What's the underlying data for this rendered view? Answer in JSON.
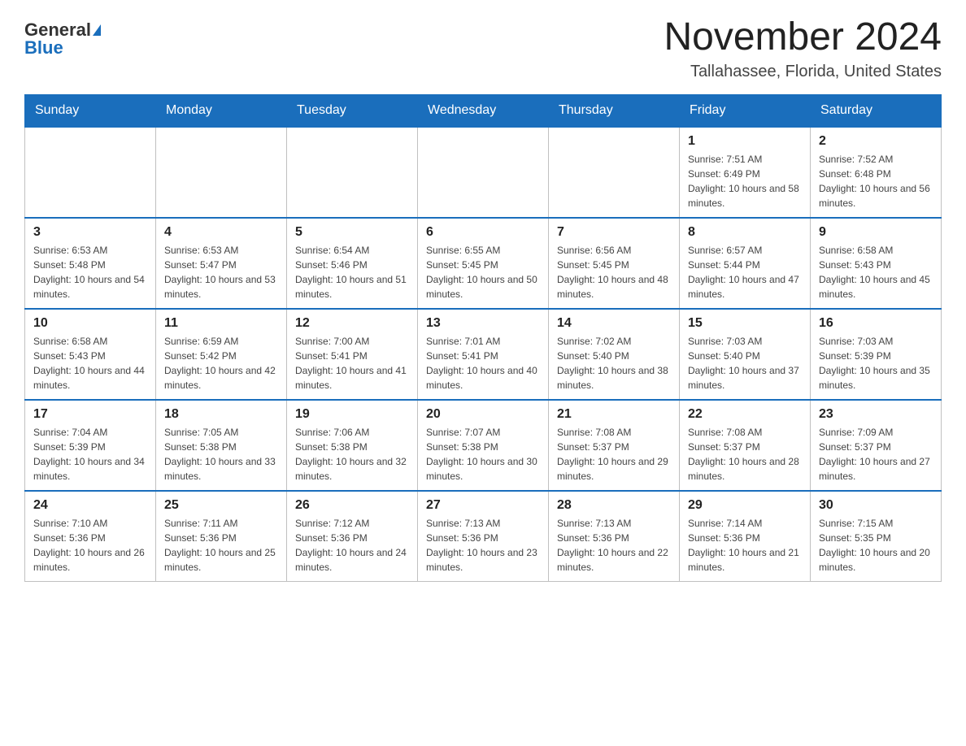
{
  "header": {
    "logo_general": "General",
    "logo_blue": "Blue",
    "month_title": "November 2024",
    "location": "Tallahassee, Florida, United States"
  },
  "days_of_week": [
    "Sunday",
    "Monday",
    "Tuesday",
    "Wednesday",
    "Thursday",
    "Friday",
    "Saturday"
  ],
  "weeks": [
    [
      {
        "day": "",
        "sunrise": "",
        "sunset": "",
        "daylight": ""
      },
      {
        "day": "",
        "sunrise": "",
        "sunset": "",
        "daylight": ""
      },
      {
        "day": "",
        "sunrise": "",
        "sunset": "",
        "daylight": ""
      },
      {
        "day": "",
        "sunrise": "",
        "sunset": "",
        "daylight": ""
      },
      {
        "day": "",
        "sunrise": "",
        "sunset": "",
        "daylight": ""
      },
      {
        "day": "1",
        "sunrise": "Sunrise: 7:51 AM",
        "sunset": "Sunset: 6:49 PM",
        "daylight": "Daylight: 10 hours and 58 minutes."
      },
      {
        "day": "2",
        "sunrise": "Sunrise: 7:52 AM",
        "sunset": "Sunset: 6:48 PM",
        "daylight": "Daylight: 10 hours and 56 minutes."
      }
    ],
    [
      {
        "day": "3",
        "sunrise": "Sunrise: 6:53 AM",
        "sunset": "Sunset: 5:48 PM",
        "daylight": "Daylight: 10 hours and 54 minutes."
      },
      {
        "day": "4",
        "sunrise": "Sunrise: 6:53 AM",
        "sunset": "Sunset: 5:47 PM",
        "daylight": "Daylight: 10 hours and 53 minutes."
      },
      {
        "day": "5",
        "sunrise": "Sunrise: 6:54 AM",
        "sunset": "Sunset: 5:46 PM",
        "daylight": "Daylight: 10 hours and 51 minutes."
      },
      {
        "day": "6",
        "sunrise": "Sunrise: 6:55 AM",
        "sunset": "Sunset: 5:45 PM",
        "daylight": "Daylight: 10 hours and 50 minutes."
      },
      {
        "day": "7",
        "sunrise": "Sunrise: 6:56 AM",
        "sunset": "Sunset: 5:45 PM",
        "daylight": "Daylight: 10 hours and 48 minutes."
      },
      {
        "day": "8",
        "sunrise": "Sunrise: 6:57 AM",
        "sunset": "Sunset: 5:44 PM",
        "daylight": "Daylight: 10 hours and 47 minutes."
      },
      {
        "day": "9",
        "sunrise": "Sunrise: 6:58 AM",
        "sunset": "Sunset: 5:43 PM",
        "daylight": "Daylight: 10 hours and 45 minutes."
      }
    ],
    [
      {
        "day": "10",
        "sunrise": "Sunrise: 6:58 AM",
        "sunset": "Sunset: 5:43 PM",
        "daylight": "Daylight: 10 hours and 44 minutes."
      },
      {
        "day": "11",
        "sunrise": "Sunrise: 6:59 AM",
        "sunset": "Sunset: 5:42 PM",
        "daylight": "Daylight: 10 hours and 42 minutes."
      },
      {
        "day": "12",
        "sunrise": "Sunrise: 7:00 AM",
        "sunset": "Sunset: 5:41 PM",
        "daylight": "Daylight: 10 hours and 41 minutes."
      },
      {
        "day": "13",
        "sunrise": "Sunrise: 7:01 AM",
        "sunset": "Sunset: 5:41 PM",
        "daylight": "Daylight: 10 hours and 40 minutes."
      },
      {
        "day": "14",
        "sunrise": "Sunrise: 7:02 AM",
        "sunset": "Sunset: 5:40 PM",
        "daylight": "Daylight: 10 hours and 38 minutes."
      },
      {
        "day": "15",
        "sunrise": "Sunrise: 7:03 AM",
        "sunset": "Sunset: 5:40 PM",
        "daylight": "Daylight: 10 hours and 37 minutes."
      },
      {
        "day": "16",
        "sunrise": "Sunrise: 7:03 AM",
        "sunset": "Sunset: 5:39 PM",
        "daylight": "Daylight: 10 hours and 35 minutes."
      }
    ],
    [
      {
        "day": "17",
        "sunrise": "Sunrise: 7:04 AM",
        "sunset": "Sunset: 5:39 PM",
        "daylight": "Daylight: 10 hours and 34 minutes."
      },
      {
        "day": "18",
        "sunrise": "Sunrise: 7:05 AM",
        "sunset": "Sunset: 5:38 PM",
        "daylight": "Daylight: 10 hours and 33 minutes."
      },
      {
        "day": "19",
        "sunrise": "Sunrise: 7:06 AM",
        "sunset": "Sunset: 5:38 PM",
        "daylight": "Daylight: 10 hours and 32 minutes."
      },
      {
        "day": "20",
        "sunrise": "Sunrise: 7:07 AM",
        "sunset": "Sunset: 5:38 PM",
        "daylight": "Daylight: 10 hours and 30 minutes."
      },
      {
        "day": "21",
        "sunrise": "Sunrise: 7:08 AM",
        "sunset": "Sunset: 5:37 PM",
        "daylight": "Daylight: 10 hours and 29 minutes."
      },
      {
        "day": "22",
        "sunrise": "Sunrise: 7:08 AM",
        "sunset": "Sunset: 5:37 PM",
        "daylight": "Daylight: 10 hours and 28 minutes."
      },
      {
        "day": "23",
        "sunrise": "Sunrise: 7:09 AM",
        "sunset": "Sunset: 5:37 PM",
        "daylight": "Daylight: 10 hours and 27 minutes."
      }
    ],
    [
      {
        "day": "24",
        "sunrise": "Sunrise: 7:10 AM",
        "sunset": "Sunset: 5:36 PM",
        "daylight": "Daylight: 10 hours and 26 minutes."
      },
      {
        "day": "25",
        "sunrise": "Sunrise: 7:11 AM",
        "sunset": "Sunset: 5:36 PM",
        "daylight": "Daylight: 10 hours and 25 minutes."
      },
      {
        "day": "26",
        "sunrise": "Sunrise: 7:12 AM",
        "sunset": "Sunset: 5:36 PM",
        "daylight": "Daylight: 10 hours and 24 minutes."
      },
      {
        "day": "27",
        "sunrise": "Sunrise: 7:13 AM",
        "sunset": "Sunset: 5:36 PM",
        "daylight": "Daylight: 10 hours and 23 minutes."
      },
      {
        "day": "28",
        "sunrise": "Sunrise: 7:13 AM",
        "sunset": "Sunset: 5:36 PM",
        "daylight": "Daylight: 10 hours and 22 minutes."
      },
      {
        "day": "29",
        "sunrise": "Sunrise: 7:14 AM",
        "sunset": "Sunset: 5:36 PM",
        "daylight": "Daylight: 10 hours and 21 minutes."
      },
      {
        "day": "30",
        "sunrise": "Sunrise: 7:15 AM",
        "sunset": "Sunset: 5:35 PM",
        "daylight": "Daylight: 10 hours and 20 minutes."
      }
    ]
  ]
}
